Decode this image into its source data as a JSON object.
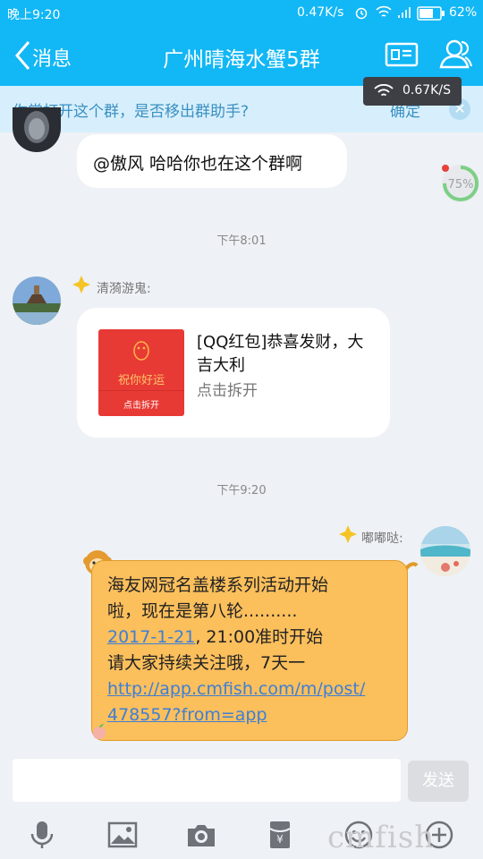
{
  "status": {
    "time": "晚上9:20",
    "speed": "0.47K/s",
    "battery": "62%"
  },
  "nav": {
    "back_label": "消息",
    "title": "广州晴海水蟹5群"
  },
  "banner": {
    "text": "你常打开这个群，是否移出群助手?",
    "confirm": "确定"
  },
  "netspeed_overlay": "0.67K/S",
  "progress_badge": "75%",
  "progress_value": 0.75,
  "messages": [
    {
      "text": "@傲风 哈哈你也在这个群啊"
    },
    {
      "time": "下午8:01"
    },
    {
      "sender": "清漪游鬼:",
      "red_packet": {
        "card_blessing": "祝你好运",
        "card_open": "点击拆开",
        "title": "[QQ红包]恭喜发财，大吉大利",
        "action": "点击拆开"
      }
    },
    {
      "time": "下午9:20"
    },
    {
      "sender": "嘟嘟哒:",
      "line1": "海友网冠名盖楼系列活动开始",
      "line2": "啦，现在是第八轮..........",
      "date_link": "2017-1-21",
      "line3_rest": ", 21:00准时开始",
      "line4": "请大家持续关注哦，7天一",
      "url_part1": "http://app.cmfish.com/m/post/",
      "url_part2": "478557?from=app"
    }
  ],
  "input": {
    "placeholder": "",
    "send_label": "发送"
  },
  "toolbar_icons": [
    "microphone-icon",
    "image-icon",
    "camera-icon",
    "red-packet-icon",
    "emoji-icon",
    "plus-icon"
  ],
  "watermark": "cmfish",
  "colors": {
    "header": "#12b7f5",
    "banner": "#d7effc",
    "bubble_orange": "#fbbf5c",
    "red_packet": "#e83a35",
    "link": "#3d7fd6"
  }
}
